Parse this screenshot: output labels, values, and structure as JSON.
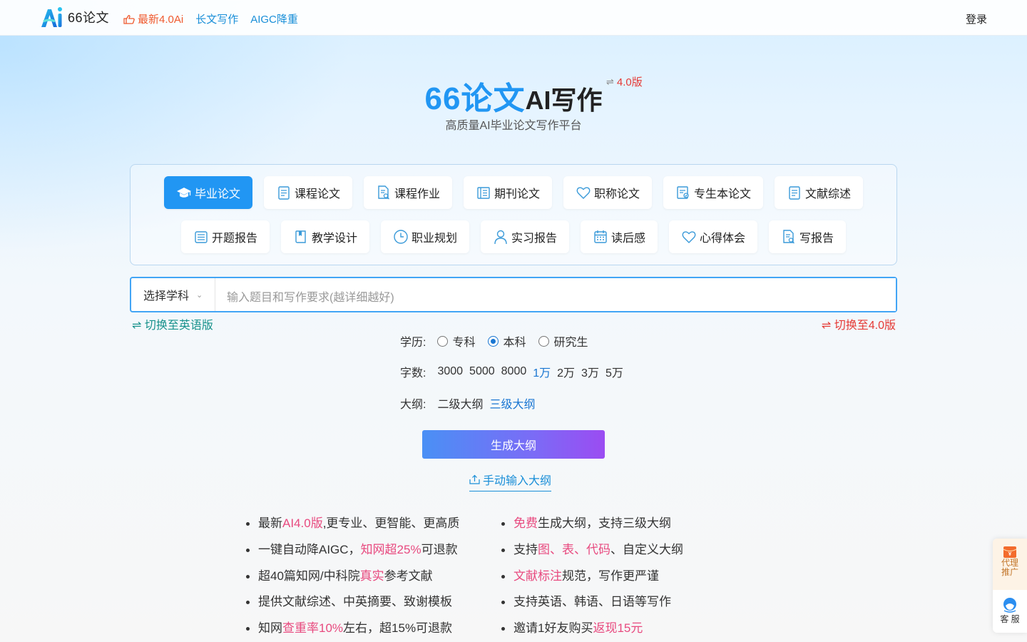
{
  "header": {
    "logo_text": "66论文",
    "nav": [
      {
        "label": "最新4.0Ai"
      },
      {
        "label": "长文写作"
      },
      {
        "label": "AIGC降重"
      }
    ],
    "login": "登录"
  },
  "hero": {
    "title_brand": "66论文",
    "title_rest": "AI写作",
    "version_switch_icon": "⇌",
    "version": "4.0版",
    "subtitle": "高质量AI毕业论文写作平台"
  },
  "paper_types": {
    "row1": [
      {
        "label": "毕业论文",
        "icon": "graduation-cap-icon",
        "active": true
      },
      {
        "label": "课程论文",
        "icon": "document-icon"
      },
      {
        "label": "课程作业",
        "icon": "search-document-icon"
      },
      {
        "label": "期刊论文",
        "icon": "journal-icon"
      },
      {
        "label": "职称论文",
        "icon": "heart-icon"
      },
      {
        "label": "专生本论文",
        "icon": "checklist-icon"
      },
      {
        "label": "文献综述",
        "icon": "document-icon"
      }
    ],
    "row2": [
      {
        "label": "开题报告",
        "icon": "report-icon"
      },
      {
        "label": "教学设计",
        "icon": "book-icon"
      },
      {
        "label": "职业规划",
        "icon": "clock-icon"
      },
      {
        "label": "实习报告",
        "icon": "user-icon"
      },
      {
        "label": "读后感",
        "icon": "calendar-icon"
      },
      {
        "label": "心得体会",
        "icon": "heart-icon"
      },
      {
        "label": "写报告",
        "icon": "search-document-icon"
      }
    ]
  },
  "input": {
    "subject_label": "选择学科",
    "placeholder": "输入题目和写作要求(越详细越好)",
    "value": ""
  },
  "switch_english": "⇌ 切换至英语版",
  "switch_v4": "⇌ 切换至4.0版",
  "education": {
    "label": "学历:",
    "options": [
      "专科",
      "本科",
      "研究生"
    ],
    "selected": "本科"
  },
  "word_count": {
    "label": "字数:",
    "options": [
      "3000",
      "5000",
      "8000",
      "1万",
      "2万",
      "3万",
      "5万"
    ],
    "selected": "1万"
  },
  "outline_level": {
    "label": "大纲:",
    "options": [
      "二级大纲",
      "三级大纲"
    ],
    "selected": "三级大纲"
  },
  "generate_button": "生成大纲",
  "manual_outline": "手动输入大纲",
  "features_left": [
    [
      {
        "t": "最新"
      },
      {
        "t": "AI4.0版",
        "hl": true
      },
      {
        "t": ",更专业、更智能、更高质"
      }
    ],
    [
      {
        "t": "一键自动降AIGC，"
      },
      {
        "t": "知网超25%",
        "hl": true
      },
      {
        "t": "可退款"
      }
    ],
    [
      {
        "t": "超40篇知网/中科院"
      },
      {
        "t": "真实",
        "hl": true
      },
      {
        "t": "参考文献"
      }
    ],
    [
      {
        "t": "提供文献综述、中英摘要、致谢模板"
      }
    ],
    [
      {
        "t": "知网"
      },
      {
        "t": "查重率10%",
        "hl": true
      },
      {
        "t": "左右，超15%可退款"
      }
    ]
  ],
  "features_right": [
    [
      {
        "t": "免费",
        "hl": true
      },
      {
        "t": "生成大纲，支持三级大纲"
      }
    ],
    [
      {
        "t": "支持"
      },
      {
        "t": "图、表、代码",
        "hl": true
      },
      {
        "t": "、自定义大纲"
      }
    ],
    [
      {
        "t": "文献标注",
        "hl": true
      },
      {
        "t": "规范，写作更严谨"
      }
    ],
    [
      {
        "t": "支持英语、韩语、日语等写作"
      }
    ],
    [
      {
        "t": "邀请1好友购买"
      },
      {
        "t": "返现15元",
        "hl": true
      }
    ]
  ],
  "side": {
    "agent_line1": "代理",
    "agent_line2": "推广",
    "service": "客 服"
  },
  "colors": {
    "accent": "#2196f3",
    "highlight": "#e84a7f",
    "version_red": "#e53935",
    "english_switch": "#16918b"
  }
}
